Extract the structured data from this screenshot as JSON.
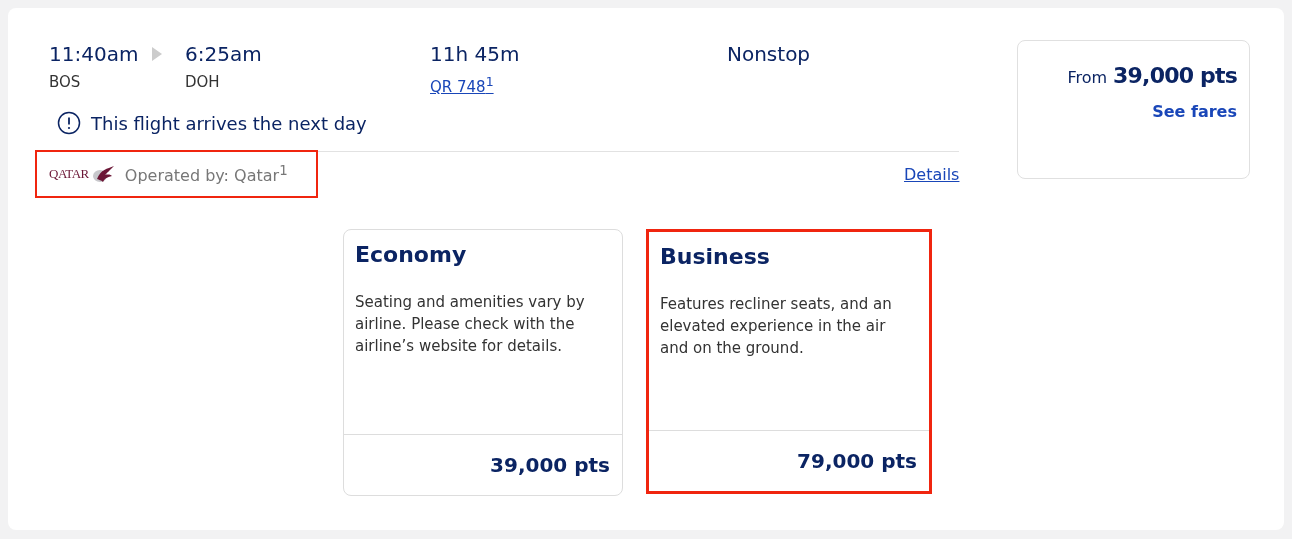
{
  "flight": {
    "departure_time": "11:40am",
    "departure_airport": "BOS",
    "arrival_time": "6:25am",
    "arrival_airport": "DOH",
    "duration": "11h 45m",
    "flight_number": "QR 748$^{1}$",
    "stops": "Nonstop",
    "notice": "This flight arrives the next day"
  },
  "operator": {
    "logo_text": "QATAR",
    "label": "Operated by: Qatar$^{1}$",
    "highlighted": true
  },
  "details_link": "Details",
  "price_summary": {
    "prefix": "From",
    "amount": "39,000 pts",
    "link": "See fares"
  },
  "fares": [
    {
      "name": "Economy",
      "description": "Seating and amenities vary by airline. Please check with the airline’s website for details.",
      "price": "39,000 pts",
      "highlighted": false
    },
    {
      "name": "Business",
      "description": "Features recliner seats, and an elevated experience in the air and on the ground.",
      "price": "79,000 pts",
      "highlighted": true
    }
  ]
}
